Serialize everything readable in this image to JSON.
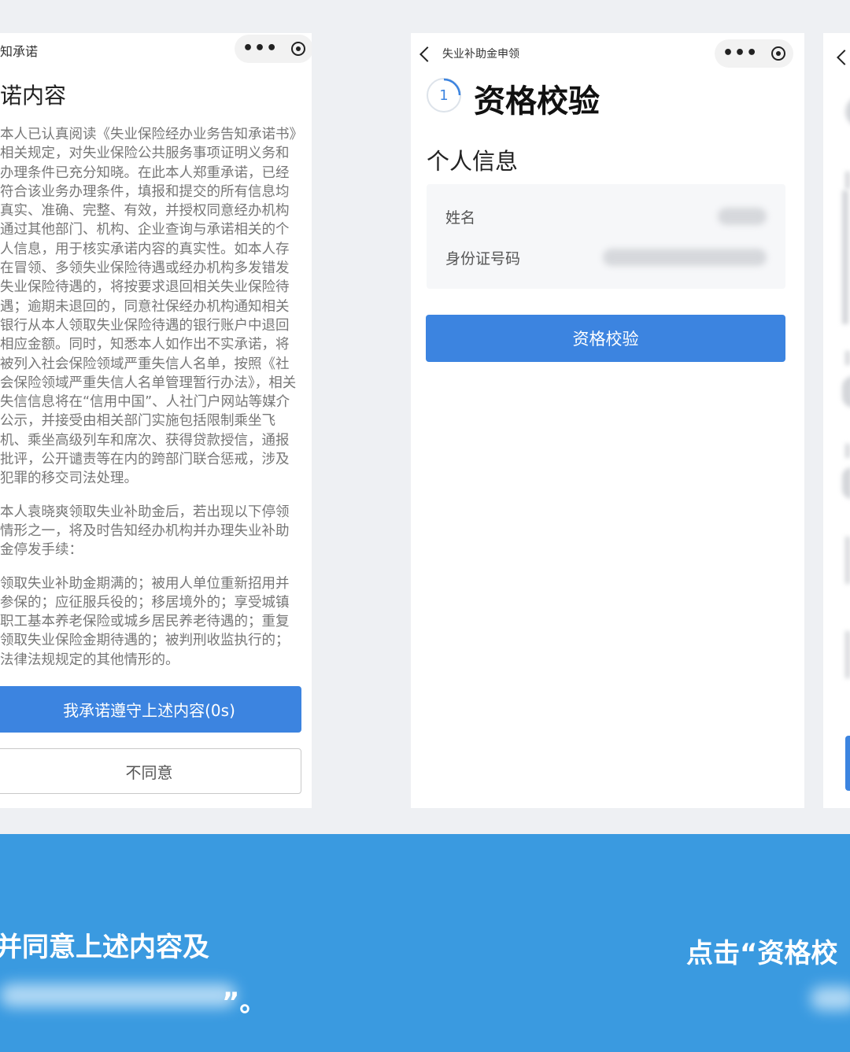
{
  "left_screen": {
    "nav_title": "知承诺",
    "title": "诺内容",
    "paragraphs": [
      "本人已认真阅读《失业保险经办业务告知承诺书》相关规定，对失业保险公共服务事项证明义务和办理条件已充分知晓。在此本人郑重承诺，已经符合该业务办理条件，填报和提交的所有信息均真实、准确、完整、有效，并授权同意经办机构通过其他部门、机构、企业查询与承诺相关的个人信息，用于核实承诺内容的真实性。如本人存在冒领、多领失业保险待遇或经办机构多发错发失业保险待遇的，将按要求退回相关失业保险待遇；逾期未退回的，同意社保经办机构通知相关银行从本人领取失业保险待遇的银行账户中退回相应金额。同时，知悉本人如作出不实承诺，将被列入社会保险领域严重失信人名单，按照《社会保险领域严重失信人名单管理暂行办法》，相关失信信息将在“信用中国”、人社门户网站等媒介公示，并接受由相关部门实施包括限制乘坐飞机、乘坐高级列车和席次、获得贷款授信，通报批评，公开谴责等在内的跨部门联合惩戒，涉及犯罪的移交司法处理。",
      "本人袁晓爽领取失业补助金后，若出现以下停领情形之一，将及时告知经办机构并办理失业补助金停发手续：",
      "领取失业补助金期满的；被用人单位重新招用并参保的；应征服兵役的；移居境外的；享受城镇职工基本养老保险或城乡居民养老待遇的；重复领取失业保险金期待遇的；被判刑收监执行的；法律法规规定的其他情形的。"
    ],
    "agree_button": "我承诺遵守上述内容(0s)",
    "disagree_button": "不同意"
  },
  "middle_screen": {
    "nav_title": "失业补助金申领",
    "step_number": "1",
    "title": "资格校验",
    "section_title": "个人信息",
    "fields": [
      {
        "label": "姓名"
      },
      {
        "label": "身份证号码"
      }
    ],
    "verify_button": "资格校验"
  },
  "captions": {
    "left_line1": "并同意上述内容及",
    "left_line2_end": "”。",
    "right_line1": "点击“资格校"
  }
}
